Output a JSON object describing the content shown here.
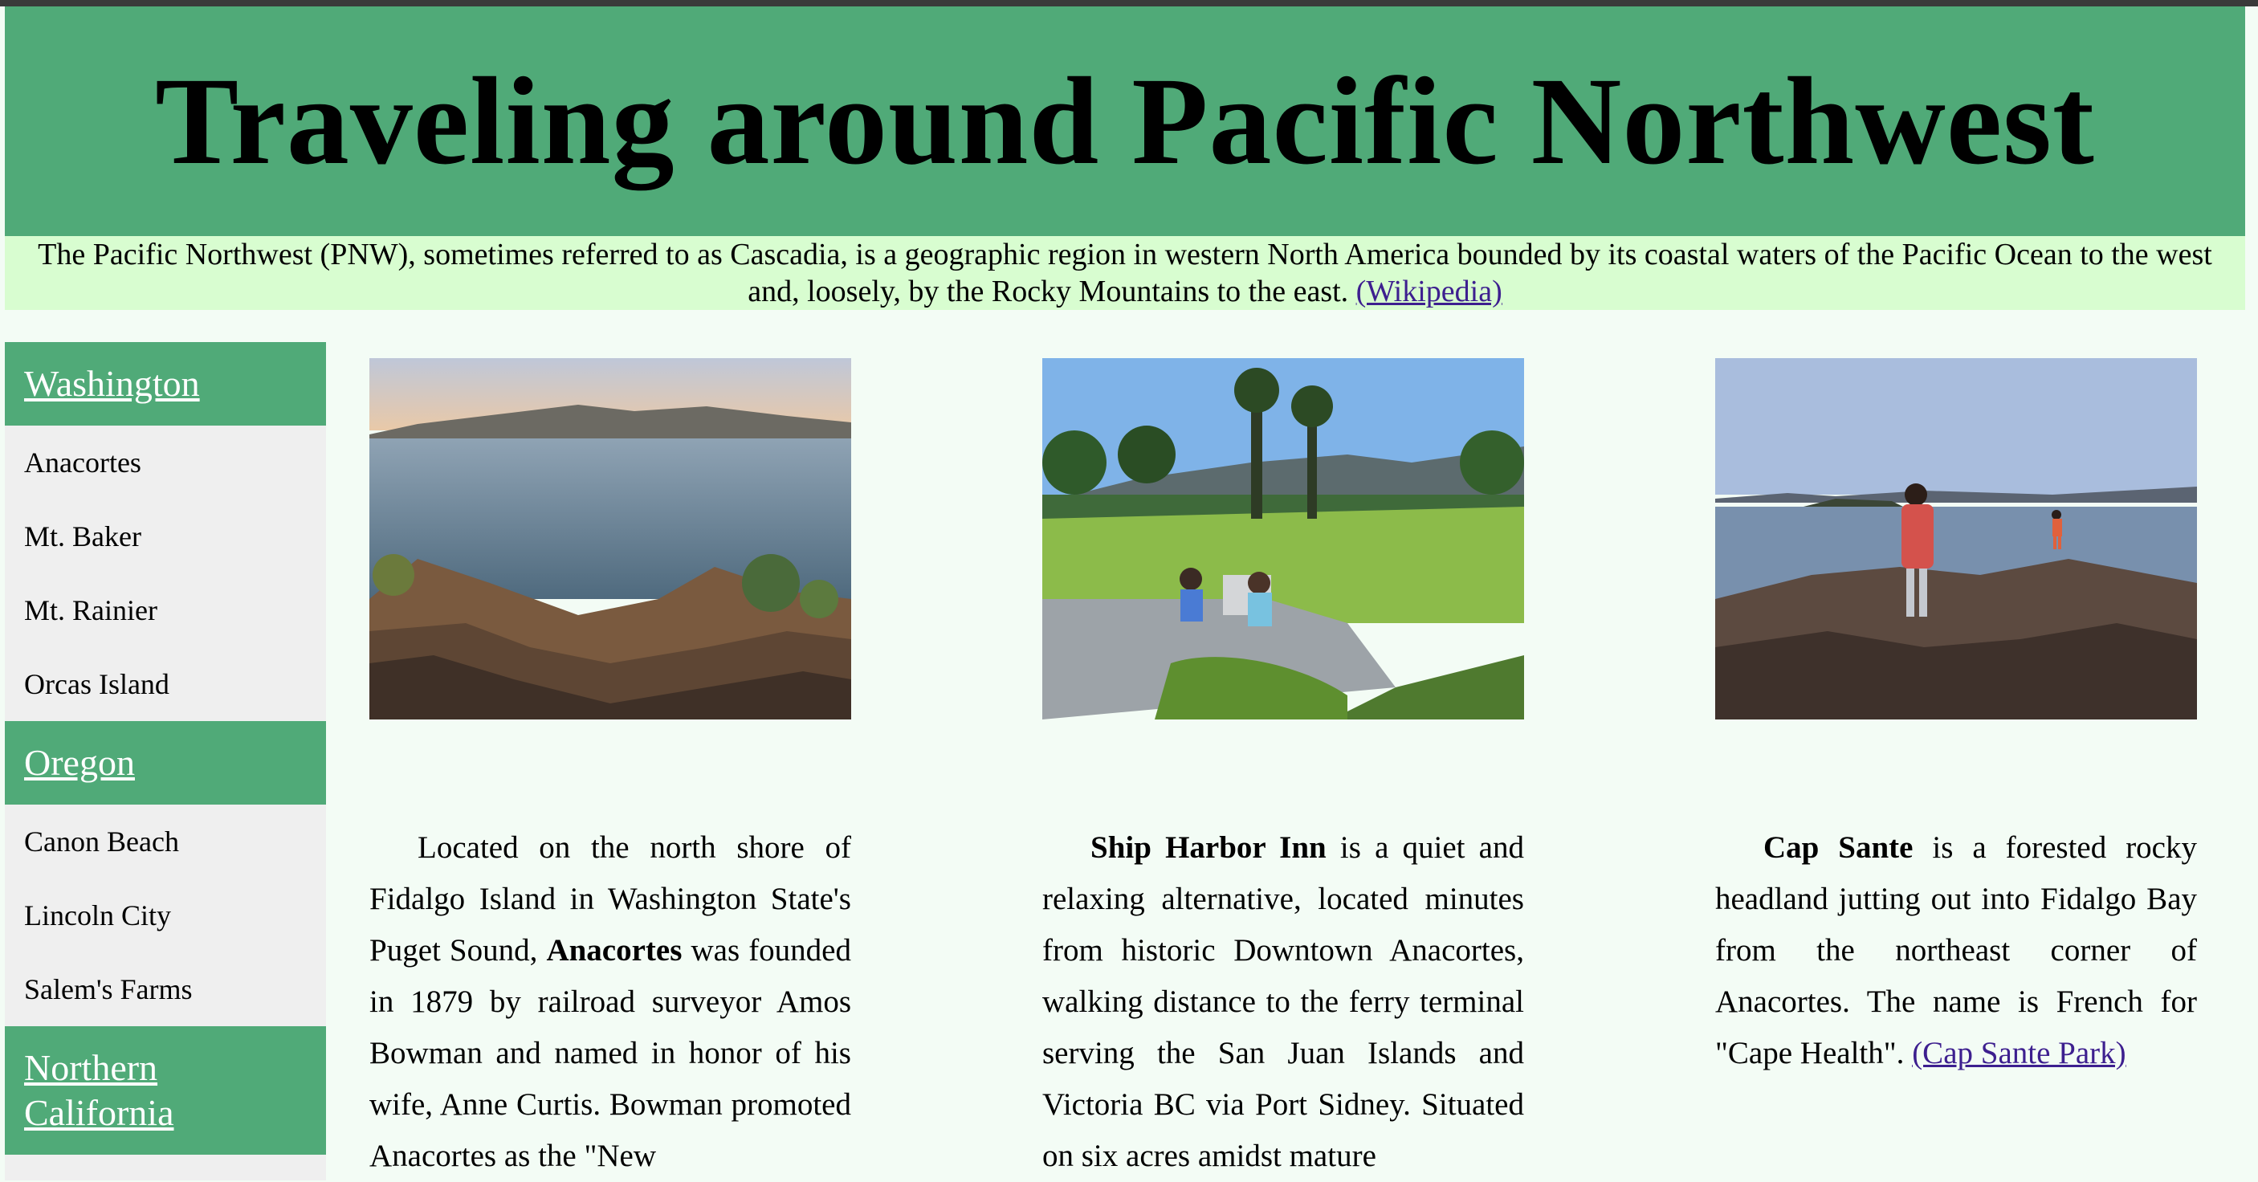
{
  "header": {
    "title": "Traveling around Pacific Northwest"
  },
  "intro": {
    "text": "The Pacific Northwest (PNW), sometimes referred to as Cascadia, is a geographic region in western North America bounded by its coastal waters of the Pacific Ocean to the west and, loosely, by the Rocky Mountains to the east.",
    "link": "(Wikipedia)"
  },
  "sidebar": {
    "sections": [
      {
        "title": "Washington",
        "items": [
          "Anacortes",
          "Mt. Baker",
          "Mt. Rainier",
          "Orcas Island"
        ]
      },
      {
        "title": "Oregon",
        "items": [
          "Canon Beach",
          "Lincoln City",
          "Salem's Farms"
        ]
      },
      {
        "title": "Northern California",
        "items": []
      }
    ]
  },
  "columns": [
    {
      "photo_icon": "coastal-bay-photo",
      "pre": "Located on the north shore of Fidalgo Island in Washington State's Puget Sound, ",
      "bold": "Anacortes",
      "post": " was founded in 1879 by railroad surveyor Amos Bowman and named in honor of his wife, Anne Curtis. Bowman promoted Anacortes as the \"New",
      "link": ""
    },
    {
      "photo_icon": "lawn-garden-photo",
      "pre": "",
      "bold": "Ship Harbor Inn",
      "post": " is a quiet and relaxing alternative, located minutes from historic Downtown Anacortes, walking distance to the ferry terminal serving the San Juan Islands and Victoria BC via Port Sidney. Situated on six acres amidst mature",
      "link": ""
    },
    {
      "photo_icon": "rocky-headland-photo",
      "pre": "",
      "bold": "Cap Sante",
      "post": " is a forested rocky headland jutting out into Fidalgo Bay from the northeast corner of Anacortes. The name is French for \"Cape Health\". ",
      "link": "(Cap Sante Park)"
    }
  ],
  "colors": {
    "green": "#50aa78",
    "lightgreen": "#d8fdd0",
    "background": "#f3fcf5",
    "link": "#3d1f8f"
  }
}
